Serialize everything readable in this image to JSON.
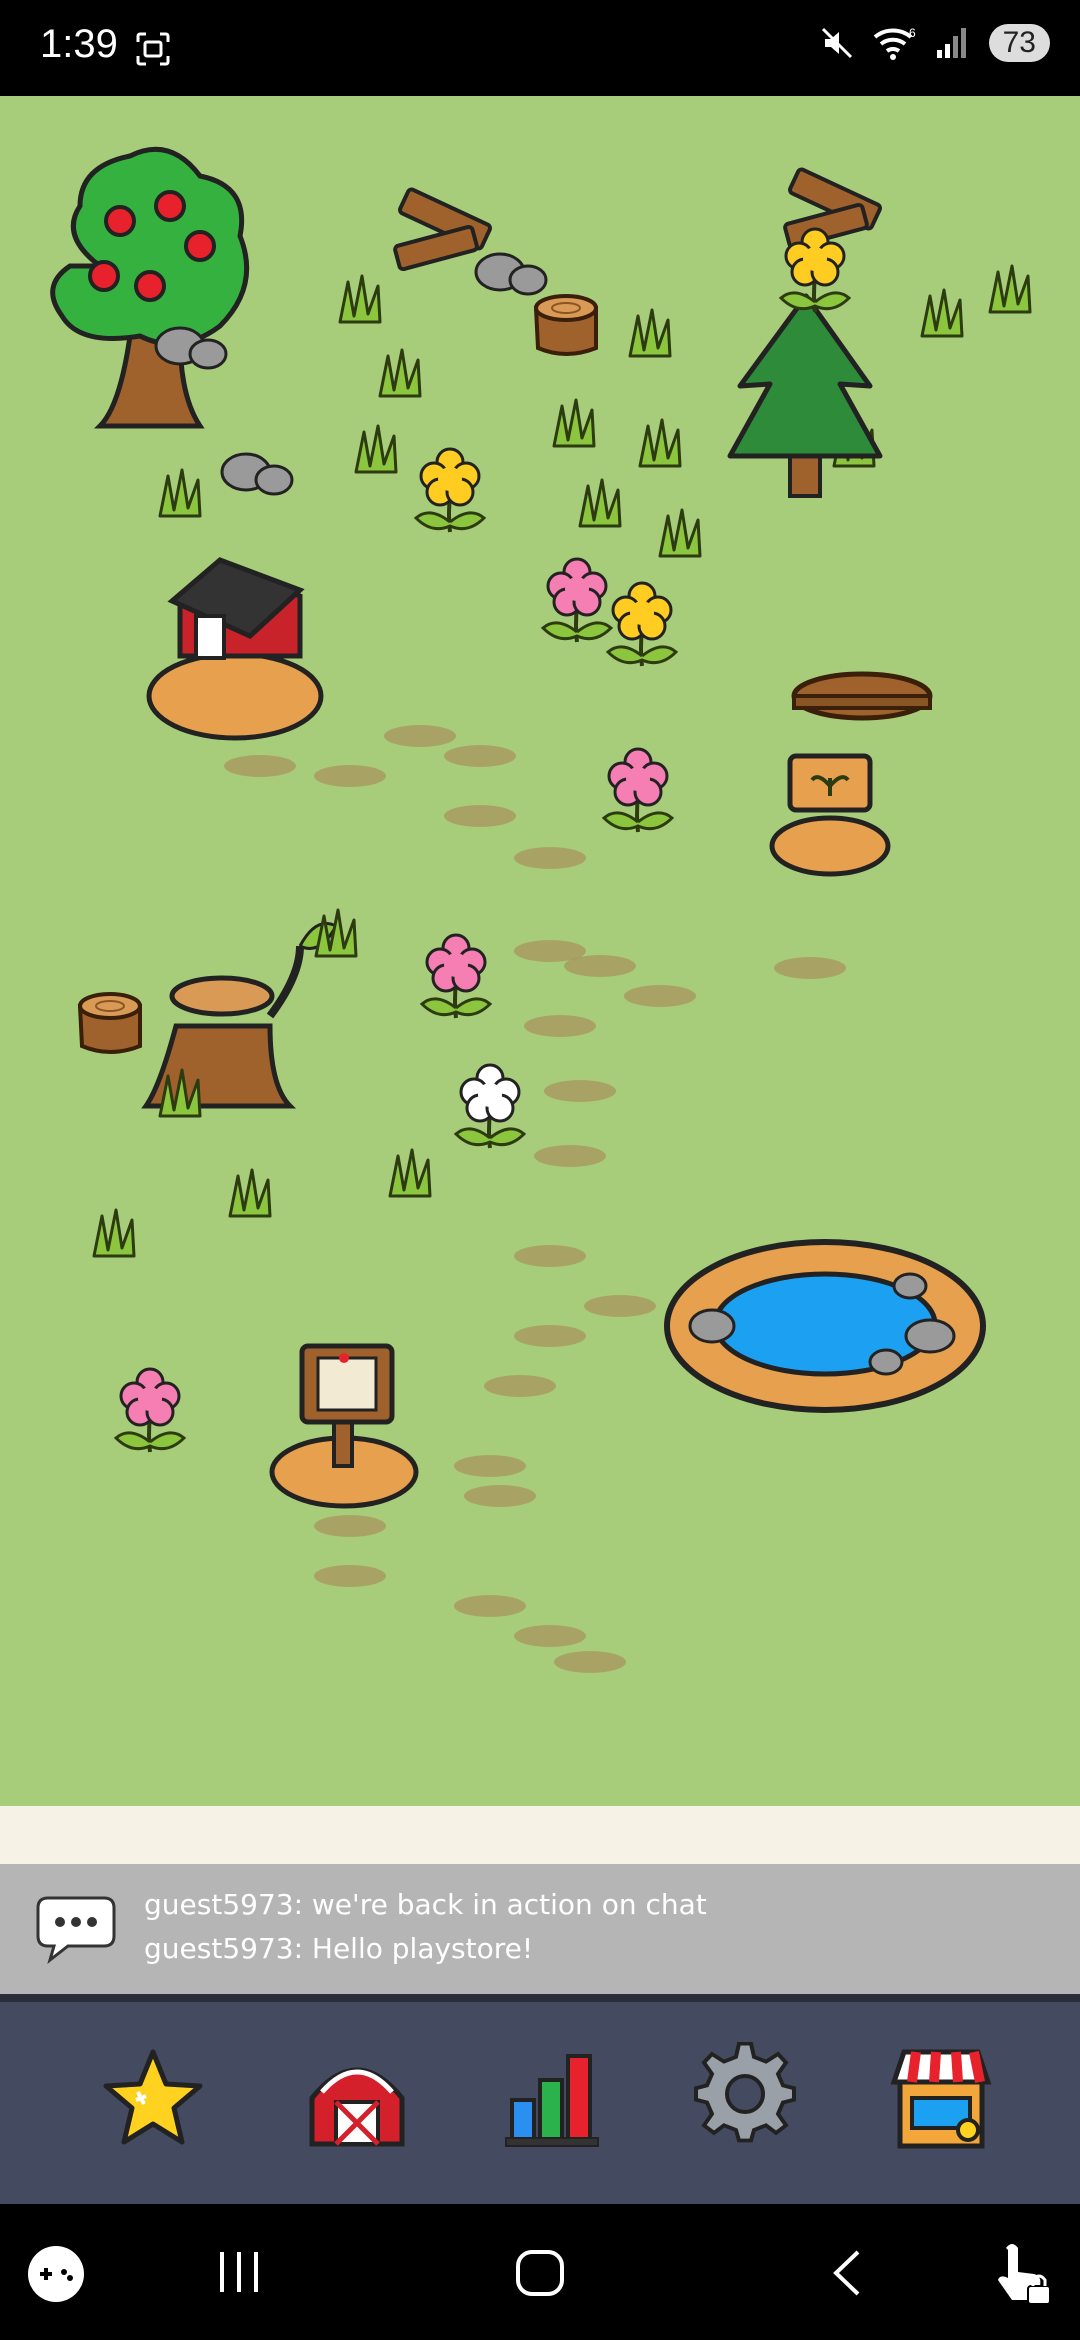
{
  "status_bar": {
    "time": "1:39",
    "battery": "73",
    "icons": [
      "screenshot-icon",
      "mute-icon",
      "wifi-icon",
      "signal-icon"
    ]
  },
  "chat": {
    "messages": [
      "guest5973: we're back in action on chat",
      "guest5973: Hello playstore!"
    ]
  },
  "toolbar": {
    "buttons": [
      "star-icon",
      "barn-icon",
      "stats-icon",
      "gear-icon",
      "shop-icon"
    ]
  },
  "nav": {
    "buttons": [
      "gamepad-icon",
      "recents-icon",
      "home-icon",
      "back-icon",
      "touch-lock-icon"
    ]
  },
  "colors": {
    "grass": "#a8cd7a",
    "toolbar": "#444a60",
    "chat": "#b5b5b5"
  }
}
